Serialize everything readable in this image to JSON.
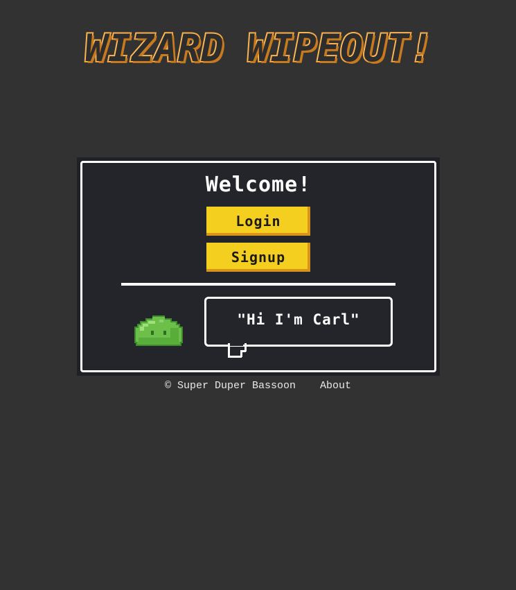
{
  "logo": {
    "title": "WIZARD WIPEOUT!",
    "fill_color": "#2d2d2d",
    "outline_color": "#f5a742"
  },
  "panel": {
    "title": "Welcome!",
    "login_label": "Login",
    "signup_label": "Signup",
    "button_color": "#f5cf1f"
  },
  "character": {
    "name": "slime-icon",
    "speech": "\"Hi I'm Carl\""
  },
  "footer": {
    "copyright": "© Super Duper Bassoon",
    "about_label": "About"
  }
}
